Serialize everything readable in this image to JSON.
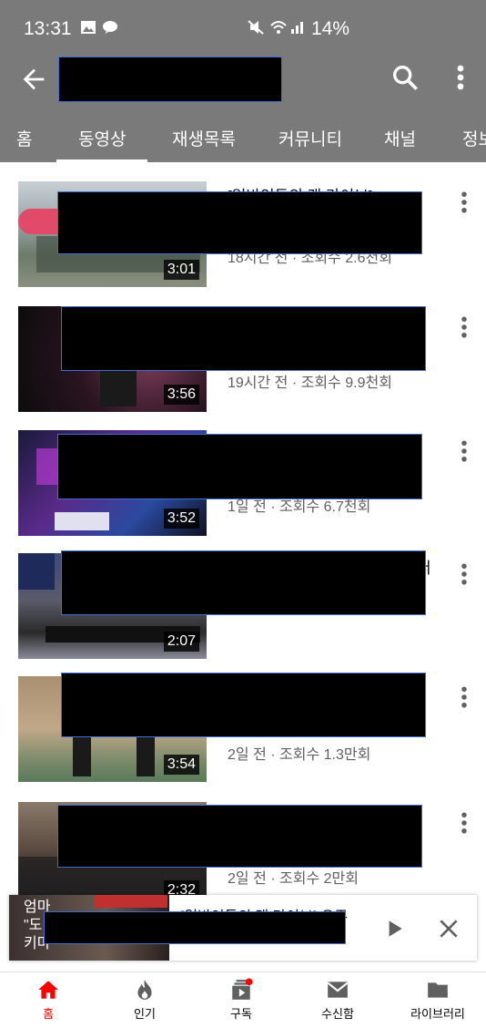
{
  "status_bar": {
    "time": "13:31",
    "battery": "14%"
  },
  "app_bar": {
    "back_icon": "arrow-back-icon",
    "search_icon": "search-icon",
    "more_icon": "more-vert-icon"
  },
  "tabs": [
    {
      "label": "홈"
    },
    {
      "label": "동영상"
    },
    {
      "label": "재생목록"
    },
    {
      "label": "커뮤니티"
    },
    {
      "label": "채널"
    },
    {
      "label": "정보"
    }
  ],
  "active_tab": "동영상",
  "videos": [
    {
      "duration": "3:01",
      "title_fragment": "[일반인들의 랜 라이브]",
      "meta": "18시간 전 · 조회수 2.6천회"
    },
    {
      "duration": "3:56",
      "title_fragment": "",
      "meta": "19시간 전 · 조회수 9.9천회"
    },
    {
      "duration": "3:52",
      "title_fragment": "",
      "meta": "1일 전 · 조회수 6.7천회"
    },
    {
      "duration": "2:07",
      "title_fragment": "퍼",
      "meta": ""
    },
    {
      "duration": "3:54",
      "title_fragment": ")",
      "meta": "2일 전 · 조회수 1.3만회"
    },
    {
      "duration": "2:32",
      "title_fragment": "",
      "meta": "2일 전 · 조회수 2만회"
    }
  ],
  "mini_player": {
    "title_fragment": "[일반인들의 랜 라이브] 우주",
    "thumb_text_1": "엄마",
    "thumb_text_2": "\"도",
    "thumb_text_3": "키마"
  },
  "bottom_nav": [
    {
      "label": "홈",
      "icon": "home-icon"
    },
    {
      "label": "인기",
      "icon": "fire-icon"
    },
    {
      "label": "구독",
      "icon": "subscriptions-icon"
    },
    {
      "label": "수신함",
      "icon": "mail-icon"
    },
    {
      "label": "라이브러리",
      "icon": "library-icon"
    }
  ],
  "colors": {
    "app_bar": "#7a7a7a",
    "accent": "#ff0000",
    "redaction": "#000000"
  }
}
